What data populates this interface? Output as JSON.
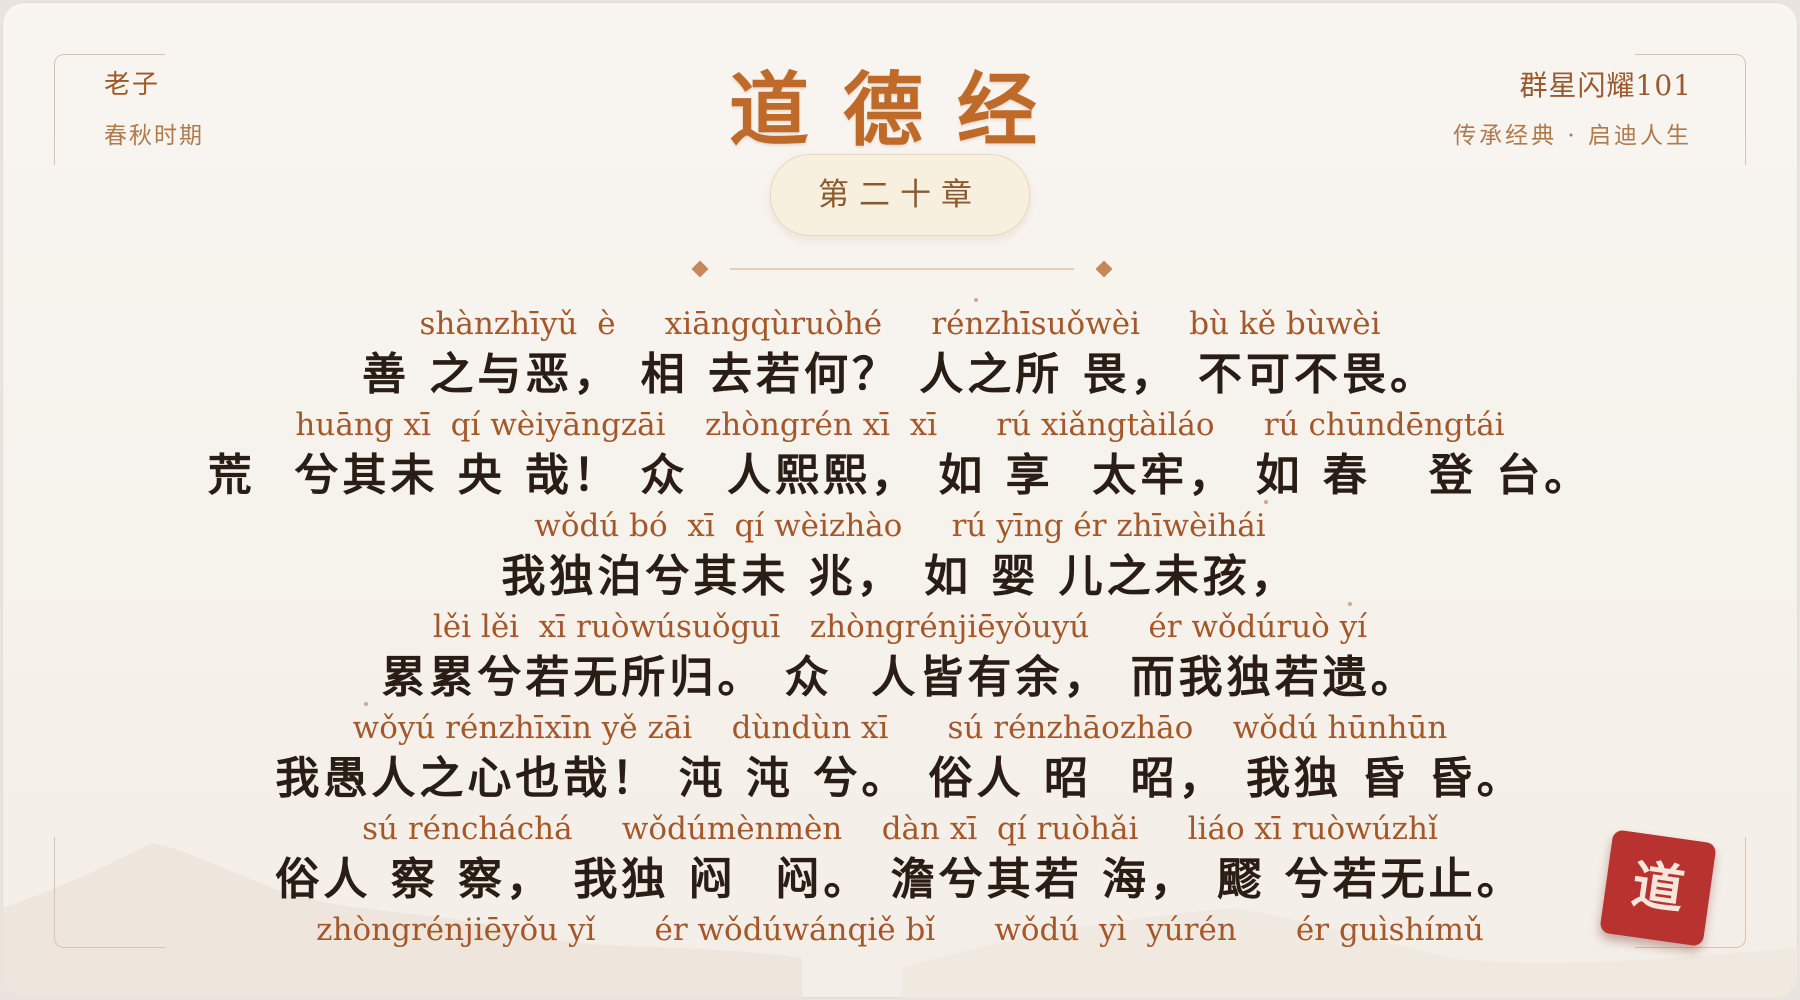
{
  "header": {
    "author": "老子",
    "era": "春秋时期",
    "title": "道德经",
    "chapter": "第二十章",
    "brand": "群星闪耀101",
    "motto": "传承经典 · 启迪人生"
  },
  "verse": [
    {
      "pinyin": "shànzhīyǔ  è     xiāngqùruòhé     rénzhīsuǒwèi     bù kě bùwèi",
      "hanzi": "善 之与恶， 相 去若何？ 人之所 畏， 不可不畏。"
    },
    {
      "pinyin": "huāng xī  qí wèiyāngzāi    zhòngrén xī  xī      rú xiǎngtàiláo     rú chūndēngtái",
      "hanzi": "荒  兮其未 央 哉！ 众  人熙熙， 如 享  太牢， 如 春   登 台。"
    },
    {
      "pinyin": "wǒdú bó  xī  qí wèizhào     rú yīng ér zhīwèihái",
      "hanzi": "我独泊兮其未 兆， 如 婴 儿之未孩，"
    },
    {
      "pinyin": "lěi lěi  xī ruòwúsuǒguī   zhòngrénjiēyǒuyú      ér wǒdúruò yí",
      "hanzi": "累累兮若无所归。 众  人皆有余， 而我独若遗。"
    },
    {
      "pinyin": "wǒyú rénzhīxīn yě zāi    dùndùn xī      sú rénzhāozhāo    wǒdú hūnhūn",
      "hanzi": "我愚人之心也哉！ 沌 沌 兮。 俗人 昭  昭， 我独 昏 昏。"
    },
    {
      "pinyin": "sú réncháchá     wǒdúmènmèn    dàn xī  qí ruòhǎi     liáo xī ruòwúzhǐ",
      "hanzi": "俗人 察 察， 我独 闷  闷。 澹兮其若 海， 飂 兮若无止。"
    }
  ],
  "next_pinyin": "zhòngrénjiēyǒu yǐ      ér wǒdúwánqiě bǐ      wǒdú  yì  yúrén      ér guìshímǔ",
  "seal": "道",
  "colors": {
    "accent": "#c06a2a",
    "seal": "#b8322f",
    "text": "#2a1d16",
    "pinyin": "#a4582a"
  }
}
